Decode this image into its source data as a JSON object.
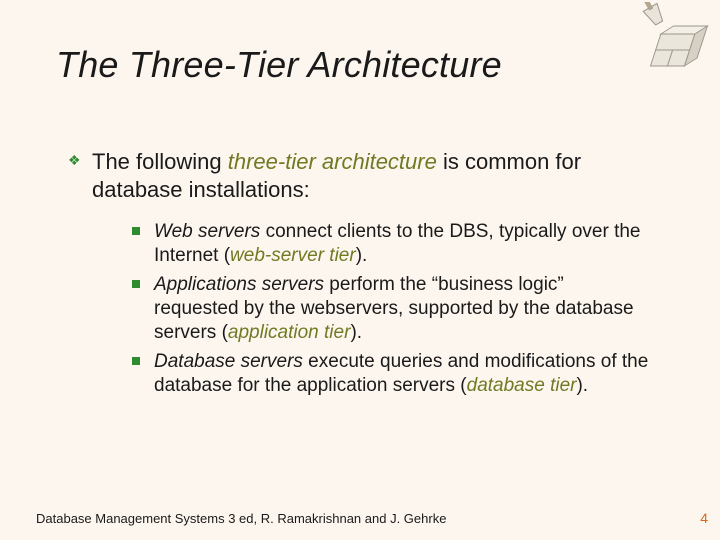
{
  "title": "The Three-Tier Architecture",
  "intro": {
    "pre": "The following ",
    "term": "three-tier architecture",
    "post": " is common for database installations:"
  },
  "items": [
    {
      "lead_i": "Web servers",
      "mid1": " connect clients to the DBS, typically over the Internet (",
      "paren_i": "web-server tier",
      "tail": ")."
    },
    {
      "lead_i": "Applications servers",
      "mid1": " perform the “business logic” requested by the webservers, supported by the database servers (",
      "paren_i": "application tier",
      "tail": ")."
    },
    {
      "lead_i": "Database servers",
      "mid1": " execute queries and modifications of the database for the application servers (",
      "paren_i": "database tier",
      "tail": ")."
    }
  ],
  "footer": "Database Management Systems 3 ed,  R. Ramakrishnan and J. Gehrke",
  "page": "4"
}
